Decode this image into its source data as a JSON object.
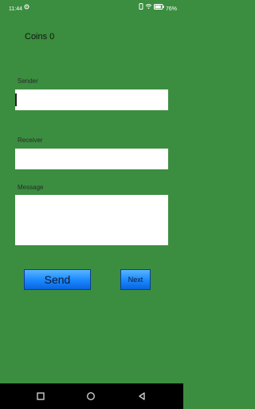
{
  "status_bar": {
    "time": "11:44",
    "battery": "76%",
    "icons": [
      "settings-icon",
      "vibrate-icon",
      "wifi-icon",
      "battery-icon"
    ]
  },
  "coins_label": "Coins 0",
  "sender": {
    "label": "Sender",
    "value": ""
  },
  "receiver": {
    "label": "Receiver",
    "value": ""
  },
  "message": {
    "label": "Message",
    "value": ""
  },
  "buttons": {
    "send": "Send",
    "next": "Next"
  },
  "colors": {
    "background": "#3b8e3f",
    "button_blue": "#1d8bff",
    "field_bg": "#ffffff",
    "nav_bar": "#000000"
  },
  "nav_bar": {
    "icons": [
      "recents-square-icon",
      "home-circle-icon",
      "back-triangle-icon"
    ]
  }
}
